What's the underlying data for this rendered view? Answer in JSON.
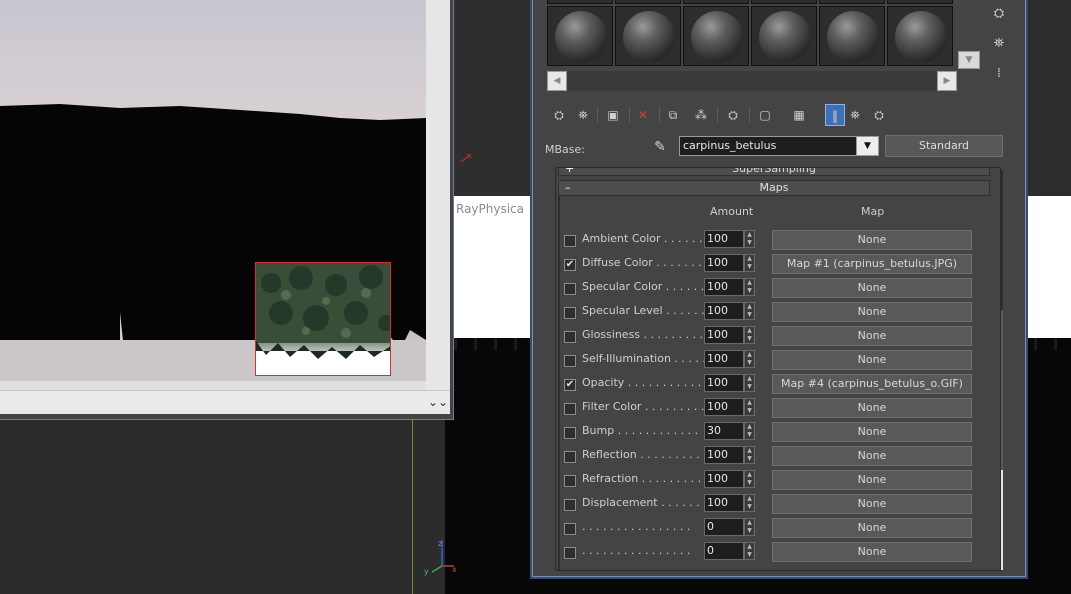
{
  "viewport": {
    "label": "RayPhysica"
  },
  "material_editor": {
    "mbase_label": "MBase:",
    "material_name": "carpinus_betulus",
    "material_type": "Standard",
    "rollouts": {
      "supersampling": "SuperSampling",
      "supersampling_sign": "+",
      "maps": "Maps",
      "maps_sign": "–"
    },
    "maps_table": {
      "header_amount": "Amount",
      "header_map": "Map",
      "rows": [
        {
          "label": "Ambient Color . . . . . . .",
          "checked": false,
          "amount": "100",
          "map": "None"
        },
        {
          "label": "Diffuse Color . . . . . . . .",
          "checked": true,
          "amount": "100",
          "map": "Map #1 (carpinus_betulus.JPG)"
        },
        {
          "label": "Specular Color . . . . . .",
          "checked": false,
          "amount": "100",
          "map": "None"
        },
        {
          "label": "Specular Level . . . . . .",
          "checked": false,
          "amount": "100",
          "map": "None"
        },
        {
          "label": "Glossiness . . . . . . . . .",
          "checked": false,
          "amount": "100",
          "map": "None"
        },
        {
          "label": "Self-Illumination . . . . .",
          "checked": false,
          "amount": "100",
          "map": "None"
        },
        {
          "label": "Opacity . . . . . . . . . . .",
          "checked": true,
          "amount": "100",
          "map": "Map #4 (carpinus_betulus_o.GIF)"
        },
        {
          "label": "Filter Color . . . . . . . . .",
          "checked": false,
          "amount": "100",
          "map": "None"
        },
        {
          "label": "Bump . . . . . . . . . . . .",
          "checked": false,
          "amount": "30",
          "map": "None"
        },
        {
          "label": "Reflection . . . . . . . . .",
          "checked": false,
          "amount": "100",
          "map": "None"
        },
        {
          "label": "Refraction . . . . . . . . .",
          "checked": false,
          "amount": "100",
          "map": "None"
        },
        {
          "label": "Displacement . . . . . . .",
          "checked": false,
          "amount": "100",
          "map": "None"
        },
        {
          "label": ". . . . . . . . . . . . . . . .",
          "checked": false,
          "amount": "0",
          "map": "None"
        },
        {
          "label": ". . . . . . . . . . . . . . . .",
          "checked": false,
          "amount": "0",
          "map": "None"
        }
      ]
    },
    "icons": {
      "check": "✔",
      "spin_up": "▲",
      "spin_down": "▼",
      "dropdown": "▼",
      "scroll_left": "◀",
      "scroll_right": "▶",
      "lock": "🔒"
    }
  },
  "render_window": {
    "expand_glyph": "⌄⌄"
  },
  "colors": {
    "accent_blue": "#3d72c0",
    "region_red": "#d23030"
  }
}
